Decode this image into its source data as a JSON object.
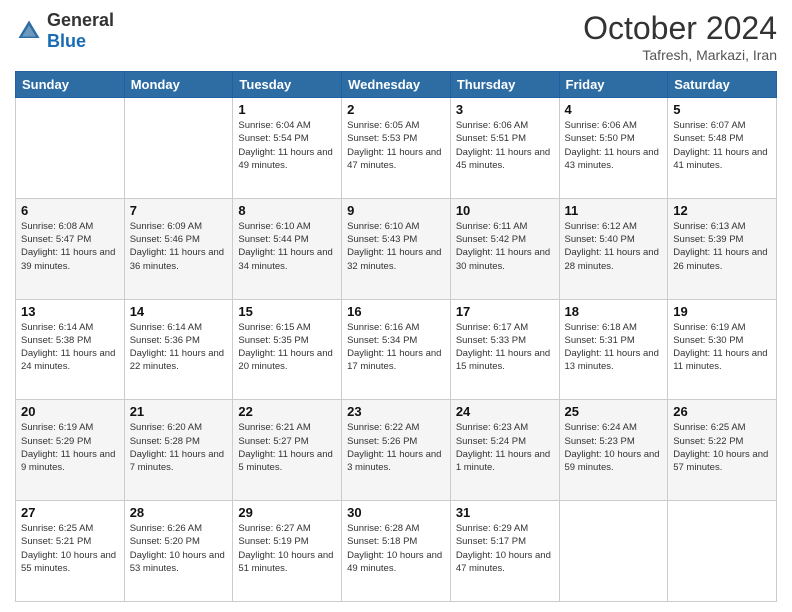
{
  "header": {
    "logo_general": "General",
    "logo_blue": "Blue",
    "title": "October 2024",
    "location": "Tafresh, Markazi, Iran"
  },
  "calendar": {
    "days_of_week": [
      "Sunday",
      "Monday",
      "Tuesday",
      "Wednesday",
      "Thursday",
      "Friday",
      "Saturday"
    ],
    "weeks": [
      [
        {
          "day": "",
          "info": ""
        },
        {
          "day": "",
          "info": ""
        },
        {
          "day": "1",
          "info": "Sunrise: 6:04 AM\nSunset: 5:54 PM\nDaylight: 11 hours and 49 minutes."
        },
        {
          "day": "2",
          "info": "Sunrise: 6:05 AM\nSunset: 5:53 PM\nDaylight: 11 hours and 47 minutes."
        },
        {
          "day": "3",
          "info": "Sunrise: 6:06 AM\nSunset: 5:51 PM\nDaylight: 11 hours and 45 minutes."
        },
        {
          "day": "4",
          "info": "Sunrise: 6:06 AM\nSunset: 5:50 PM\nDaylight: 11 hours and 43 minutes."
        },
        {
          "day": "5",
          "info": "Sunrise: 6:07 AM\nSunset: 5:48 PM\nDaylight: 11 hours and 41 minutes."
        }
      ],
      [
        {
          "day": "6",
          "info": "Sunrise: 6:08 AM\nSunset: 5:47 PM\nDaylight: 11 hours and 39 minutes."
        },
        {
          "day": "7",
          "info": "Sunrise: 6:09 AM\nSunset: 5:46 PM\nDaylight: 11 hours and 36 minutes."
        },
        {
          "day": "8",
          "info": "Sunrise: 6:10 AM\nSunset: 5:44 PM\nDaylight: 11 hours and 34 minutes."
        },
        {
          "day": "9",
          "info": "Sunrise: 6:10 AM\nSunset: 5:43 PM\nDaylight: 11 hours and 32 minutes."
        },
        {
          "day": "10",
          "info": "Sunrise: 6:11 AM\nSunset: 5:42 PM\nDaylight: 11 hours and 30 minutes."
        },
        {
          "day": "11",
          "info": "Sunrise: 6:12 AM\nSunset: 5:40 PM\nDaylight: 11 hours and 28 minutes."
        },
        {
          "day": "12",
          "info": "Sunrise: 6:13 AM\nSunset: 5:39 PM\nDaylight: 11 hours and 26 minutes."
        }
      ],
      [
        {
          "day": "13",
          "info": "Sunrise: 6:14 AM\nSunset: 5:38 PM\nDaylight: 11 hours and 24 minutes."
        },
        {
          "day": "14",
          "info": "Sunrise: 6:14 AM\nSunset: 5:36 PM\nDaylight: 11 hours and 22 minutes."
        },
        {
          "day": "15",
          "info": "Sunrise: 6:15 AM\nSunset: 5:35 PM\nDaylight: 11 hours and 20 minutes."
        },
        {
          "day": "16",
          "info": "Sunrise: 6:16 AM\nSunset: 5:34 PM\nDaylight: 11 hours and 17 minutes."
        },
        {
          "day": "17",
          "info": "Sunrise: 6:17 AM\nSunset: 5:33 PM\nDaylight: 11 hours and 15 minutes."
        },
        {
          "day": "18",
          "info": "Sunrise: 6:18 AM\nSunset: 5:31 PM\nDaylight: 11 hours and 13 minutes."
        },
        {
          "day": "19",
          "info": "Sunrise: 6:19 AM\nSunset: 5:30 PM\nDaylight: 11 hours and 11 minutes."
        }
      ],
      [
        {
          "day": "20",
          "info": "Sunrise: 6:19 AM\nSunset: 5:29 PM\nDaylight: 11 hours and 9 minutes."
        },
        {
          "day": "21",
          "info": "Sunrise: 6:20 AM\nSunset: 5:28 PM\nDaylight: 11 hours and 7 minutes."
        },
        {
          "day": "22",
          "info": "Sunrise: 6:21 AM\nSunset: 5:27 PM\nDaylight: 11 hours and 5 minutes."
        },
        {
          "day": "23",
          "info": "Sunrise: 6:22 AM\nSunset: 5:26 PM\nDaylight: 11 hours and 3 minutes."
        },
        {
          "day": "24",
          "info": "Sunrise: 6:23 AM\nSunset: 5:24 PM\nDaylight: 11 hours and 1 minute."
        },
        {
          "day": "25",
          "info": "Sunrise: 6:24 AM\nSunset: 5:23 PM\nDaylight: 10 hours and 59 minutes."
        },
        {
          "day": "26",
          "info": "Sunrise: 6:25 AM\nSunset: 5:22 PM\nDaylight: 10 hours and 57 minutes."
        }
      ],
      [
        {
          "day": "27",
          "info": "Sunrise: 6:25 AM\nSunset: 5:21 PM\nDaylight: 10 hours and 55 minutes."
        },
        {
          "day": "28",
          "info": "Sunrise: 6:26 AM\nSunset: 5:20 PM\nDaylight: 10 hours and 53 minutes."
        },
        {
          "day": "29",
          "info": "Sunrise: 6:27 AM\nSunset: 5:19 PM\nDaylight: 10 hours and 51 minutes."
        },
        {
          "day": "30",
          "info": "Sunrise: 6:28 AM\nSunset: 5:18 PM\nDaylight: 10 hours and 49 minutes."
        },
        {
          "day": "31",
          "info": "Sunrise: 6:29 AM\nSunset: 5:17 PM\nDaylight: 10 hours and 47 minutes."
        },
        {
          "day": "",
          "info": ""
        },
        {
          "day": "",
          "info": ""
        }
      ]
    ]
  }
}
